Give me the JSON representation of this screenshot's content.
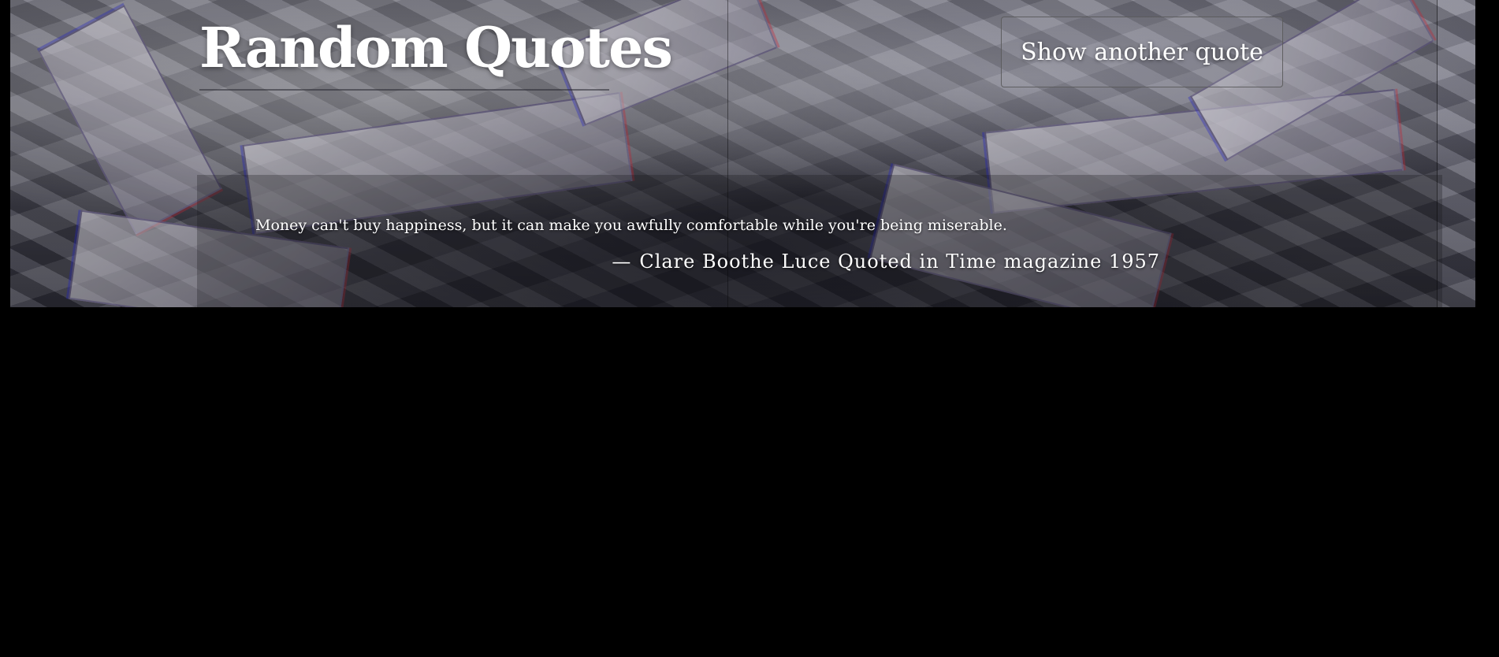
{
  "header": {
    "title": "Random Quotes",
    "next_quote_label": "Show another quote"
  },
  "quote": {
    "text": "Money can't buy happiness, but it can make you awfully comfortable while you're being miserable.",
    "dash": "—",
    "author": "Clare Boothe Luce Quoted in Time magazine 1957"
  },
  "theme": {
    "page_background": "#000000",
    "text_color": "#ffffff"
  },
  "background_image": {
    "subject": "scattered-dollar-bills"
  }
}
